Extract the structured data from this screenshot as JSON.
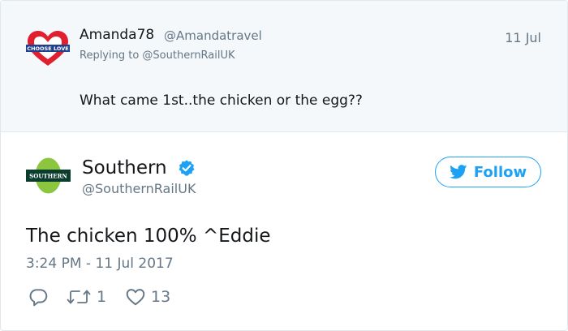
{
  "reply_tweet": {
    "display_name": "Amanda78",
    "handle": "@Amandatravel",
    "date": "11 Jul",
    "replying_to": "Replying to @SouthernRailUK",
    "text": "What came 1st..the chicken or the egg??",
    "avatar_caption": "CHOOSE LOVE",
    "avatar_icon": "red-heart-icon"
  },
  "main_tweet": {
    "display_name": "Southern",
    "handle": "@SouthernRailUK",
    "verified_icon": "verified-badge-icon",
    "follow_label": "Follow",
    "text": "The chicken 100% ^Eddie",
    "timestamp": "3:24 PM - 11 Jul 2017",
    "avatar_caption": "SOUTHERN",
    "actions": {
      "reply_icon": "reply-icon",
      "retweet_icon": "retweet-icon",
      "retweet_count": "1",
      "like_icon": "heart-outline-icon",
      "like_count": "13"
    }
  },
  "colors": {
    "twitter_blue": "#1da1f2",
    "muted_text": "#657786",
    "reply_background": "#f5f8fa",
    "southern_green": "#8cc63f",
    "southern_dark": "#0b3d2e"
  }
}
